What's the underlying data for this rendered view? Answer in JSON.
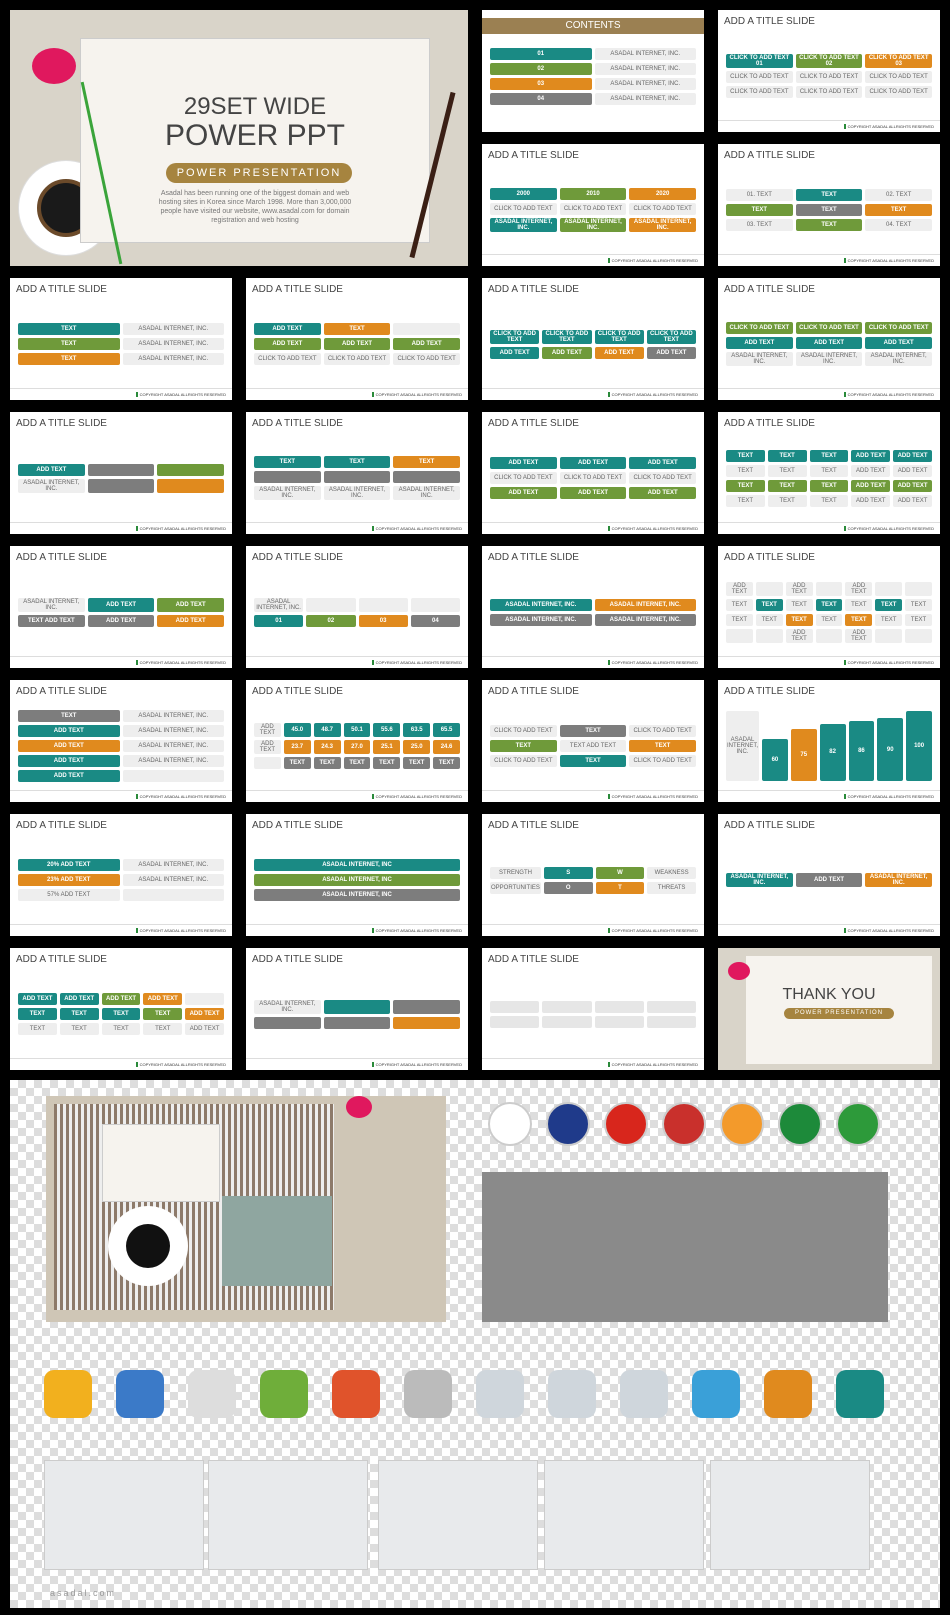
{
  "colors": {
    "teal": "#1a8a84",
    "green": "#6f9a3a",
    "orange": "#e08a1e",
    "gray": "#7d7d7d",
    "brown": "#9b8052",
    "light": "#e6e6e6"
  },
  "cover": {
    "line1": "29SET WIDE",
    "line2": "POWER PPT",
    "subtitle": "POWER PRESENTATION",
    "description": "Asadal has been running one of the biggest domain and web hosting sites in Korea since March 1998.  More than 3,000,000 people have visited our website, www.asadal.com for domain registration and web hosting"
  },
  "footer": "COPYRIGHT ASADAL ALLRIGHTS RESERVED",
  "slides": [
    {
      "title": "CONTENTS",
      "cols": 2,
      "items": [
        [
          "01",
          "teal"
        ],
        [
          "ASADAL INTERNET, INC.",
          "plain"
        ],
        [
          "02",
          "green"
        ],
        [
          "ASADAL INTERNET, INC.",
          "plain"
        ],
        [
          "03",
          "orange"
        ],
        [
          "ASADAL INTERNET, INC.",
          "plain"
        ],
        [
          "04",
          "gray"
        ],
        [
          "ASADAL INTERNET, INC.",
          "plain"
        ]
      ]
    },
    {
      "title": "ADD A TITLE SLIDE",
      "cols": 3,
      "items": [
        [
          "CLICK TO ADD TEXT 01",
          "teal"
        ],
        [
          "CLICK TO ADD TEXT 02",
          "green"
        ],
        [
          "CLICK TO ADD TEXT 03",
          "orange"
        ],
        [
          "CLICK TO ADD TEXT",
          "plain"
        ],
        [
          "CLICK TO ADD TEXT",
          "plain"
        ],
        [
          "CLICK TO ADD TEXT",
          "plain"
        ],
        [
          "CLICK TO ADD TEXT",
          "plain"
        ],
        [
          "CLICK TO ADD TEXT",
          "plain"
        ],
        [
          "CLICK TO ADD TEXT",
          "plain"
        ]
      ]
    },
    {
      "title": "ADD A TITLE SLIDE",
      "cols": 3,
      "items": [
        [
          "2000",
          "teal"
        ],
        [
          "2010",
          "green"
        ],
        [
          "2020",
          "orange"
        ],
        [
          "CLICK TO ADD TEXT",
          "plain"
        ],
        [
          "CLICK TO ADD TEXT",
          "plain"
        ],
        [
          "CLICK TO ADD TEXT",
          "plain"
        ],
        [
          "ASADAL INTERNET, INC.",
          "teal"
        ],
        [
          "ASADAL INTERNET, INC.",
          "green"
        ],
        [
          "ASADAL INTERNET, INC.",
          "orange"
        ]
      ]
    },
    {
      "title": "ADD A TITLE SLIDE",
      "cols": 3,
      "items": [
        [
          "01. TEXT",
          "plain"
        ],
        [
          "TEXT",
          "teal"
        ],
        [
          "02. TEXT",
          "plain"
        ],
        [
          "TEXT",
          "green"
        ],
        [
          "TEXT",
          "gray"
        ],
        [
          "TEXT",
          "orange"
        ],
        [
          "03. TEXT",
          "plain"
        ],
        [
          "TEXT",
          "green"
        ],
        [
          "04. TEXT",
          "plain"
        ]
      ]
    },
    {
      "title": "ADD A TITLE SLIDE",
      "cols": 2,
      "items": [
        [
          "TEXT",
          "teal"
        ],
        [
          "ASADAL INTERNET, INC.",
          "plain"
        ],
        [
          "TEXT",
          "green"
        ],
        [
          "ASADAL INTERNET, INC.",
          "plain"
        ],
        [
          "TEXT",
          "orange"
        ],
        [
          "ASADAL INTERNET, INC.",
          "plain"
        ]
      ]
    },
    {
      "title": "ADD A TITLE SLIDE",
      "cols": 3,
      "items": [
        [
          "ADD TEXT",
          "teal"
        ],
        [
          "TEXT",
          "orange"
        ],
        [
          "",
          "plain"
        ],
        [
          "ADD TEXT",
          "green"
        ],
        [
          "ADD TEXT",
          "green"
        ],
        [
          "ADD TEXT",
          "green"
        ],
        [
          "CLICK TO ADD TEXT",
          "plain"
        ],
        [
          "CLICK TO ADD TEXT",
          "plain"
        ],
        [
          "CLICK TO ADD TEXT",
          "plain"
        ]
      ]
    },
    {
      "title": "ADD A TITLE SLIDE",
      "cols": 4,
      "items": [
        [
          "CLICK TO ADD TEXT",
          "teal"
        ],
        [
          "CLICK TO ADD TEXT",
          "teal"
        ],
        [
          "CLICK TO ADD TEXT",
          "teal"
        ],
        [
          "CLICK TO ADD TEXT",
          "teal"
        ],
        [
          "ADD TEXT",
          "teal"
        ],
        [
          "ADD TEXT",
          "green"
        ],
        [
          "ADD TEXT",
          "orange"
        ],
        [
          "ADD TEXT",
          "gray"
        ]
      ]
    },
    {
      "title": "ADD A TITLE SLIDE",
      "cols": 3,
      "items": [
        [
          "CLICK TO ADD TEXT",
          "green"
        ],
        [
          "CLICK TO ADD TEXT",
          "green"
        ],
        [
          "CLICK TO ADD TEXT",
          "green"
        ],
        [
          "ADD TEXT",
          "teal"
        ],
        [
          "ADD TEXT",
          "teal"
        ],
        [
          "ADD TEXT",
          "teal"
        ],
        [
          "ASADAL INTERNET, INC.",
          "plain"
        ],
        [
          "ASADAL INTERNET, INC.",
          "plain"
        ],
        [
          "ASADAL INTERNET, INC.",
          "plain"
        ]
      ]
    },
    {
      "title": "ADD A TITLE SLIDE",
      "cols": 3,
      "items": [
        [
          "ADD TEXT",
          "teal"
        ],
        [
          "",
          "gray"
        ],
        [
          "",
          "green"
        ],
        [
          "ASADAL INTERNET, INC.",
          "plain"
        ],
        [
          "",
          "gray"
        ],
        [
          "",
          "orange"
        ]
      ]
    },
    {
      "title": "ADD A TITLE SLIDE",
      "cols": 3,
      "items": [
        [
          "TEXT",
          "teal"
        ],
        [
          "TEXT",
          "teal"
        ],
        [
          "TEXT",
          "orange"
        ],
        [
          "",
          "gray"
        ],
        [
          "",
          "gray"
        ],
        [
          "",
          "gray"
        ],
        [
          "ASADAL INTERNET, INC.",
          "plain"
        ],
        [
          "ASADAL INTERNET, INC.",
          "plain"
        ],
        [
          "ASADAL INTERNET, INC.",
          "plain"
        ]
      ]
    },
    {
      "title": "ADD A TITLE SLIDE",
      "cols": 3,
      "items": [
        [
          "ADD TEXT",
          "teal"
        ],
        [
          "ADD TEXT",
          "teal"
        ],
        [
          "ADD TEXT",
          "teal"
        ],
        [
          "CLICK TO ADD TEXT",
          "plain"
        ],
        [
          "CLICK TO ADD TEXT",
          "plain"
        ],
        [
          "CLICK TO ADD TEXT",
          "plain"
        ],
        [
          "ADD TEXT",
          "green"
        ],
        [
          "ADD TEXT",
          "green"
        ],
        [
          "ADD TEXT",
          "green"
        ]
      ]
    },
    {
      "title": "ADD A TITLE SLIDE",
      "cols": 5,
      "items": [
        [
          "TEXT",
          "teal"
        ],
        [
          "TEXT",
          "teal"
        ],
        [
          "TEXT",
          "teal"
        ],
        [
          "ADD TEXT",
          "teal"
        ],
        [
          "ADD TEXT",
          "teal"
        ],
        [
          "TEXT",
          "plain"
        ],
        [
          "TEXT",
          "plain"
        ],
        [
          "TEXT",
          "plain"
        ],
        [
          "ADD TEXT",
          "plain"
        ],
        [
          "ADD TEXT",
          "plain"
        ],
        [
          "TEXT",
          "green"
        ],
        [
          "TEXT",
          "green"
        ],
        [
          "TEXT",
          "green"
        ],
        [
          "ADD TEXT",
          "green"
        ],
        [
          "ADD TEXT",
          "green"
        ],
        [
          "TEXT",
          "plain"
        ],
        [
          "TEXT",
          "plain"
        ],
        [
          "TEXT",
          "plain"
        ],
        [
          "ADD TEXT",
          "plain"
        ],
        [
          "ADD TEXT",
          "plain"
        ]
      ]
    },
    {
      "title": "ADD A TITLE SLIDE",
      "cols": 3,
      "items": [
        [
          "ASADAL INTERNET, INC.",
          "plain"
        ],
        [
          "ADD TEXT",
          "teal"
        ],
        [
          "ADD TEXT",
          "green"
        ],
        [
          "TEXT ADD TEXT",
          "gray"
        ],
        [
          "ADD TEXT",
          "gray"
        ],
        [
          "ADD TEXT",
          "orange"
        ]
      ]
    },
    {
      "title": "ADD A TITLE SLIDE",
      "cols": 4,
      "items": [
        [
          "ASADAL INTERNET, INC.",
          "plain"
        ],
        [
          "",
          "plain"
        ],
        [
          "",
          "plain"
        ],
        [
          "",
          "plain"
        ],
        [
          "01",
          "teal"
        ],
        [
          "02",
          "green"
        ],
        [
          "03",
          "orange"
        ],
        [
          "04",
          "gray"
        ]
      ]
    },
    {
      "title": "ADD A TITLE SLIDE",
      "cols": 2,
      "items": [
        [
          "ASADAL INTERNET, INC.",
          "teal"
        ],
        [
          "ASADAL INTERNET, INC.",
          "orange"
        ],
        [
          "ASADAL INTERNET, INC.",
          "gray"
        ],
        [
          "ASADAL INTERNET, INC.",
          "gray"
        ]
      ]
    },
    {
      "title": "ADD A TITLE SLIDE",
      "cols": 7,
      "items": [
        [
          "ADD TEXT",
          "plain"
        ],
        [
          "",
          "plain"
        ],
        [
          "ADD TEXT",
          "plain"
        ],
        [
          "",
          "plain"
        ],
        [
          "ADD TEXT",
          "plain"
        ],
        [
          "",
          "plain"
        ],
        [
          "",
          "plain"
        ],
        [
          "TEXT",
          "plain"
        ],
        [
          "TEXT",
          "teal"
        ],
        [
          "TEXT",
          "plain"
        ],
        [
          "TEXT",
          "teal"
        ],
        [
          "TEXT",
          "plain"
        ],
        [
          "TEXT",
          "teal"
        ],
        [
          "TEXT",
          "plain"
        ],
        [
          "TEXT",
          "plain"
        ],
        [
          "TEXT",
          "plain"
        ],
        [
          "TEXT",
          "orange"
        ],
        [
          "TEXT",
          "plain"
        ],
        [
          "TEXT",
          "orange"
        ],
        [
          "TEXT",
          "plain"
        ],
        [
          "TEXT",
          "plain"
        ],
        [
          "",
          "plain"
        ],
        [
          "",
          "plain"
        ],
        [
          "ADD TEXT",
          "plain"
        ],
        [
          "",
          "plain"
        ],
        [
          "ADD TEXT",
          "plain"
        ],
        [
          "",
          "plain"
        ],
        [
          "",
          "plain"
        ]
      ]
    },
    {
      "title": "ADD A TITLE SLIDE",
      "cols": 2,
      "items": [
        [
          "TEXT",
          "gray"
        ],
        [
          "ASADAL INTERNET, INC.",
          "plain"
        ],
        [
          "ADD TEXT",
          "teal"
        ],
        [
          "ASADAL INTERNET, INC.",
          "plain"
        ],
        [
          "ADD TEXT",
          "orange"
        ],
        [
          "ASADAL INTERNET, INC.",
          "plain"
        ],
        [
          "ADD TEXT",
          "teal"
        ],
        [
          "ASADAL INTERNET, INC.",
          "plain"
        ],
        [
          "ADD TEXT",
          "teal"
        ],
        [
          "",
          "plain"
        ]
      ]
    },
    {
      "title": "ADD A TITLE SLIDE",
      "cols": 7,
      "items": [
        [
          "ADD TEXT",
          "plain"
        ],
        [
          "45.0",
          "teal"
        ],
        [
          "48.7",
          "teal"
        ],
        [
          "50.1",
          "teal"
        ],
        [
          "55.6",
          "teal"
        ],
        [
          "63.5",
          "teal"
        ],
        [
          "65.5",
          "teal"
        ],
        [
          "ADD TEXT",
          "plain"
        ],
        [
          "23.7",
          "orange"
        ],
        [
          "24.3",
          "orange"
        ],
        [
          "27.0",
          "orange"
        ],
        [
          "25.1",
          "orange"
        ],
        [
          "25.0",
          "orange"
        ],
        [
          "24.6",
          "orange"
        ],
        [
          "",
          "plain"
        ],
        [
          "TEXT",
          "gray"
        ],
        [
          "TEXT",
          "gray"
        ],
        [
          "TEXT",
          "gray"
        ],
        [
          "TEXT",
          "gray"
        ],
        [
          "TEXT",
          "gray"
        ],
        [
          "TEXT",
          "gray"
        ]
      ]
    },
    {
      "title": "ADD A TITLE SLIDE",
      "cols": 3,
      "items": [
        [
          "CLICK TO ADD TEXT",
          "plain"
        ],
        [
          "TEXT",
          "gray"
        ],
        [
          "CLICK TO ADD TEXT",
          "plain"
        ],
        [
          "TEXT",
          "green"
        ],
        [
          "TEXT ADD TEXT",
          "plain"
        ],
        [
          "TEXT",
          "orange"
        ],
        [
          "CLICK TO ADD TEXT",
          "plain"
        ],
        [
          "TEXT",
          "teal"
        ],
        [
          "CLICK TO ADD TEXT",
          "plain"
        ]
      ]
    },
    {
      "title": "ADD A TITLE SLIDE",
      "cols": 7,
      "bars": [
        60,
        75,
        82,
        86,
        90,
        100
      ],
      "items": [
        [
          "ASADAL INTERNET, INC.",
          "plain"
        ],
        [
          "60",
          "teal"
        ],
        [
          "75",
          "orange"
        ],
        [
          "82",
          "teal"
        ],
        [
          "86",
          "teal"
        ],
        [
          "90",
          "teal"
        ],
        [
          "100",
          "teal"
        ]
      ]
    },
    {
      "title": "ADD A TITLE SLIDE",
      "cols": 2,
      "items": [
        [
          "20% ADD TEXT",
          "teal"
        ],
        [
          "ASADAL INTERNET, INC.",
          "plain"
        ],
        [
          "23% ADD TEXT",
          "orange"
        ],
        [
          "ASADAL INTERNET, INC.",
          "plain"
        ],
        [
          "57% ADD TEXT",
          "plain"
        ],
        [
          "",
          "plain"
        ]
      ]
    },
    {
      "title": "ADD A TITLE SLIDE",
      "cols": 1,
      "items": [
        [
          "ASADAL INTERNET, INC",
          "teal"
        ],
        [
          "ASADAL INTERNET, INC",
          "green"
        ],
        [
          "ASADAL INTERNET, INC",
          "gray"
        ]
      ]
    },
    {
      "title": "ADD A TITLE SLIDE",
      "cols": 4,
      "items": [
        [
          "STRENGTH",
          "plain"
        ],
        [
          "S",
          "teal"
        ],
        [
          "W",
          "green"
        ],
        [
          "WEAKNESS",
          "plain"
        ],
        [
          "OPPORTUNITIES",
          "plain"
        ],
        [
          "O",
          "gray"
        ],
        [
          "T",
          "orange"
        ],
        [
          "THREATS",
          "plain"
        ]
      ]
    },
    {
      "title": "ADD A TITLE SLIDE",
      "cols": 3,
      "items": [
        [
          "ASADAL INTERNET, INC.",
          "teal"
        ],
        [
          "ADD TEXT",
          "gray"
        ],
        [
          "ASADAL INTERNET, INC.",
          "orange"
        ]
      ]
    },
    {
      "title": "ADD A TITLE SLIDE",
      "cols": 5,
      "items": [
        [
          "ADD TEXT",
          "teal"
        ],
        [
          "ADD TEXT",
          "teal"
        ],
        [
          "ADD TEXT",
          "green"
        ],
        [
          "ADD TEXT",
          "orange"
        ],
        [
          "",
          "plain"
        ],
        [
          "TEXT",
          "teal"
        ],
        [
          "TEXT",
          "teal"
        ],
        [
          "TEXT",
          "teal"
        ],
        [
          "TEXT",
          "green"
        ],
        [
          "ADD TEXT",
          "orange"
        ],
        [
          "TEXT",
          "plain"
        ],
        [
          "TEXT",
          "plain"
        ],
        [
          "TEXT",
          "plain"
        ],
        [
          "TEXT",
          "plain"
        ],
        [
          "ADD TEXT",
          "plain"
        ]
      ]
    },
    {
      "title": "ADD A TITLE SLIDE",
      "cols": 3,
      "items": [
        [
          "ASADAL INTERNET, INC.",
          "plain"
        ],
        [
          "",
          "teal"
        ],
        [
          "",
          "gray"
        ],
        [
          "",
          "gray"
        ],
        [
          "",
          "gray"
        ],
        [
          "",
          "orange"
        ]
      ]
    },
    {
      "title": "ADD A TITLE SLIDE",
      "cols": 4,
      "items": [
        [
          "",
          "light"
        ],
        [
          "",
          "light"
        ],
        [
          "",
          "light"
        ],
        [
          "",
          "light"
        ],
        [
          "",
          "light"
        ],
        [
          "",
          "light"
        ],
        [
          "",
          "light"
        ],
        [
          "",
          "light"
        ]
      ]
    },
    {
      "title": "THANK YOU",
      "subtitle": "POWER PRESENTATION",
      "ending": true
    }
  ],
  "assets": {
    "flags": [
      "korea",
      "uk",
      "china",
      "usa",
      "india",
      "south-africa",
      "brazil"
    ],
    "icons": [
      "growth-chart",
      "businessman",
      "calendar",
      "plant-pot",
      "globe-arrow",
      "magnifier-book",
      "user-lock",
      "user-calendar",
      "user-note",
      "blocks-123",
      "bar-chart-3d",
      "power-magnifier"
    ],
    "watermark": "asadal.com"
  }
}
